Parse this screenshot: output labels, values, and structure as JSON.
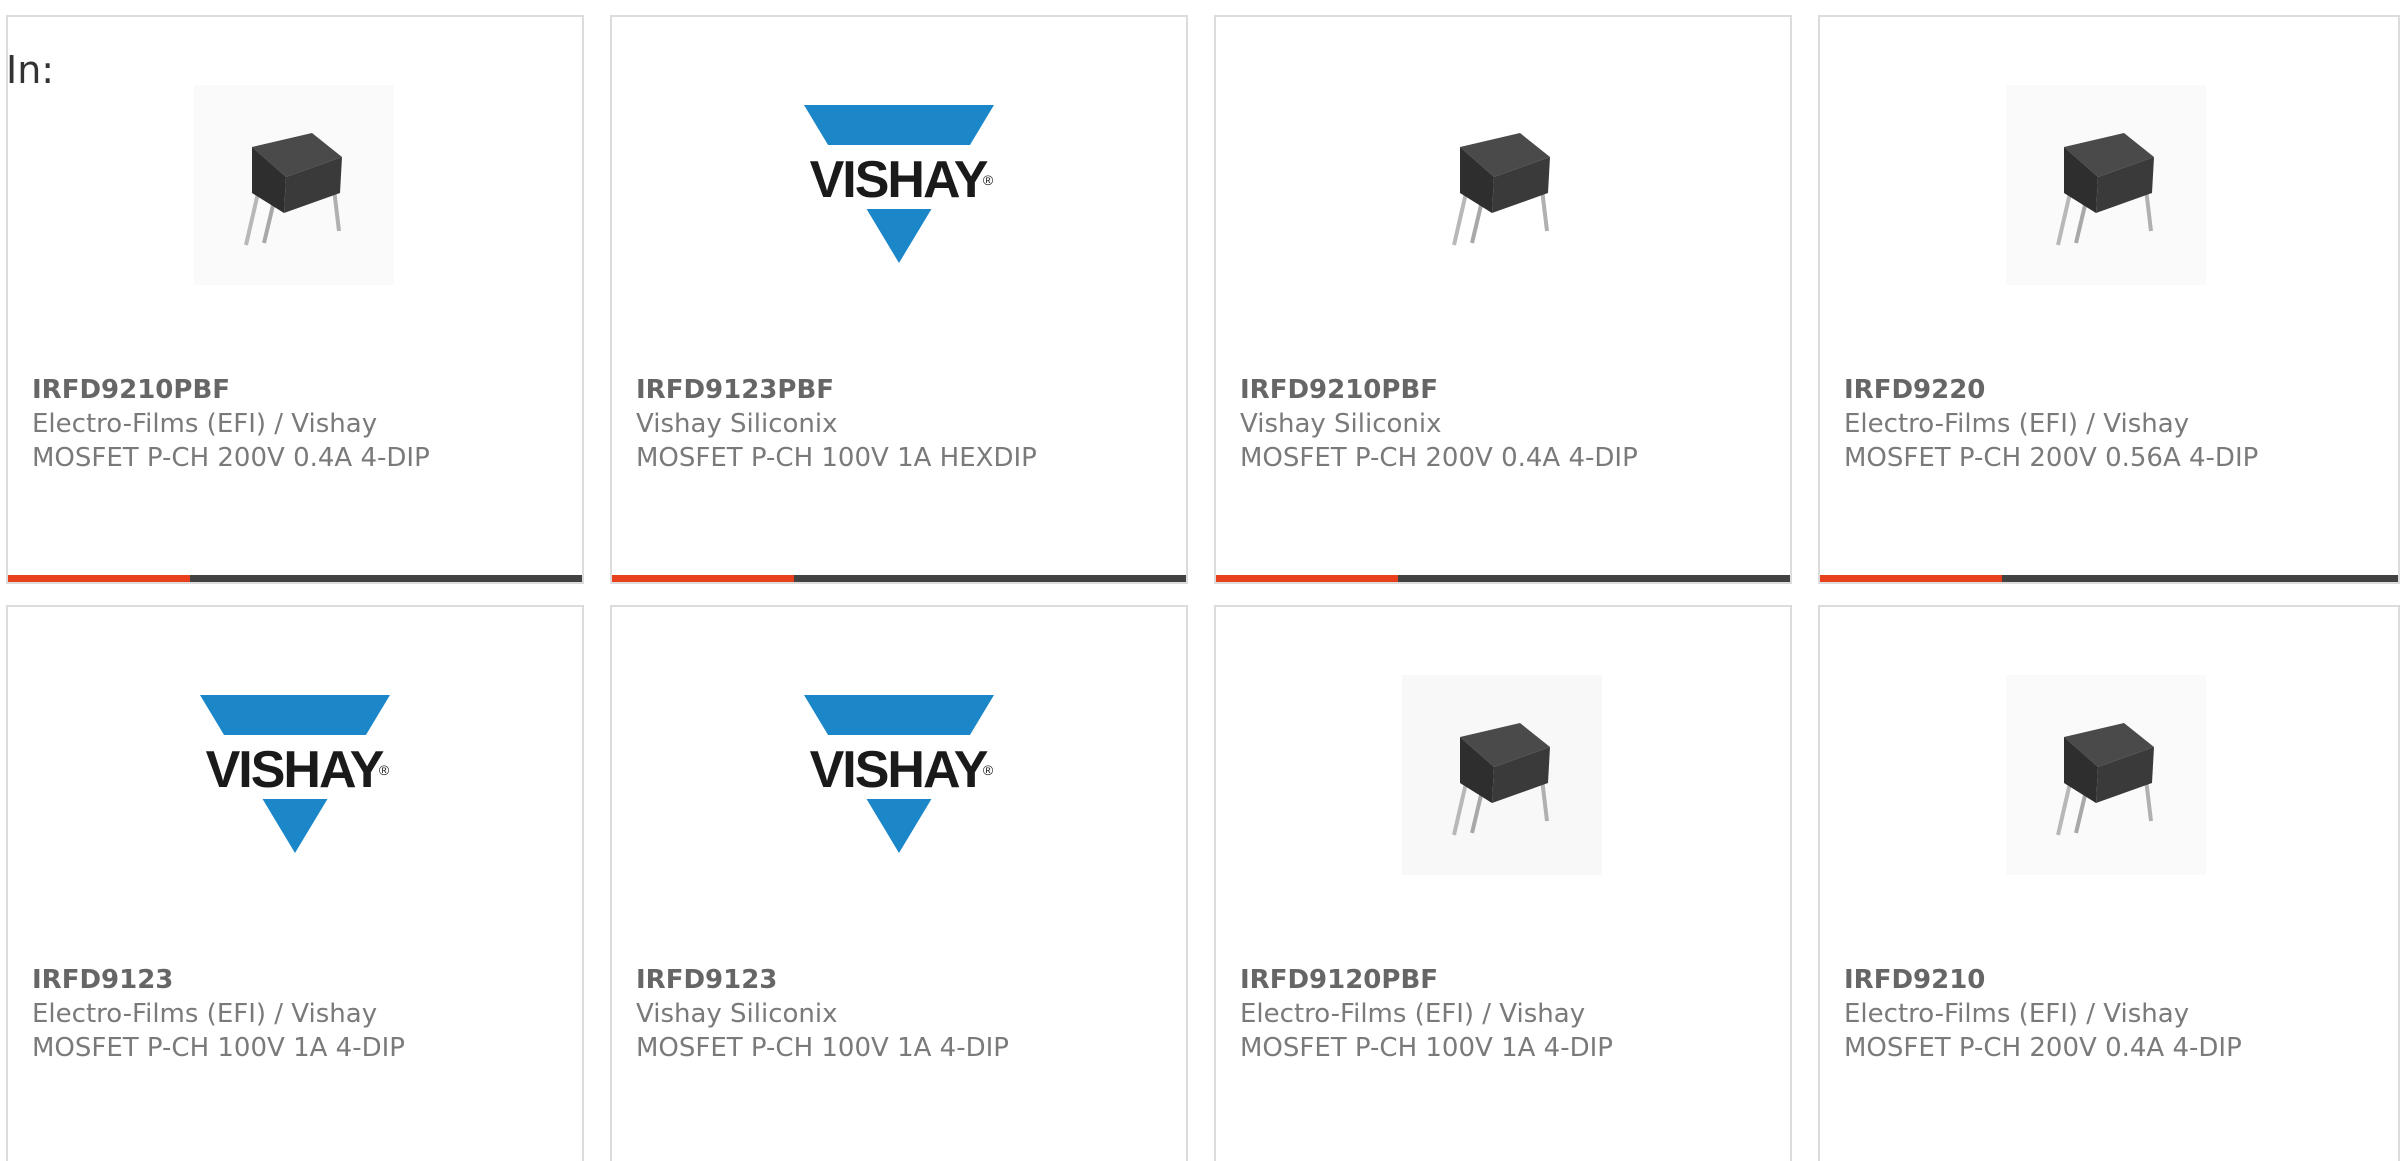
{
  "page": {
    "label": "In:"
  },
  "colors": {
    "accent": "#e8401c",
    "bar": "#424242",
    "vishay_blue": "#1b87c9",
    "border": "#dcdcdc",
    "text": "#7a7a7a"
  },
  "products": [
    {
      "part_number": "IRFD9210PBF",
      "manufacturer": "Electro-Films (EFI) / Vishay",
      "description": "MOSFET P-CH 200V 0.4A 4-DIP",
      "image": "chip-photo"
    },
    {
      "part_number": "IRFD9123PBF",
      "manufacturer": "Vishay Siliconix",
      "description": "MOSFET P-CH 100V 1A HEXDIP",
      "image": "vishay-logo"
    },
    {
      "part_number": "IRFD9210PBF",
      "manufacturer": "Vishay Siliconix",
      "description": "MOSFET P-CH 200V 0.4A 4-DIP",
      "image": "chip-photo"
    },
    {
      "part_number": "IRFD9220",
      "manufacturer": "Electro-Films (EFI) / Vishay",
      "description": "MOSFET P-CH 200V 0.56A 4-DIP",
      "image": "chip-photo"
    },
    {
      "part_number": "IRFD9123",
      "manufacturer": "Electro-Films (EFI) / Vishay",
      "description": "MOSFET P-CH 100V 1A 4-DIP",
      "image": "vishay-logo"
    },
    {
      "part_number": "IRFD9123",
      "manufacturer": "Vishay Siliconix",
      "description": "MOSFET P-CH 100V 1A 4-DIP",
      "image": "vishay-logo"
    },
    {
      "part_number": "IRFD9120PBF",
      "manufacturer": "Electro-Films (EFI) / Vishay",
      "description": "MOSFET P-CH 100V 1A 4-DIP",
      "image": "chip-photo"
    },
    {
      "part_number": "IRFD9210",
      "manufacturer": "Electro-Films (EFI) / Vishay",
      "description": "MOSFET P-CH 200V 0.4A 4-DIP",
      "image": "chip-photo"
    }
  ],
  "logo": {
    "text": "VISHAY",
    "mark": "®"
  }
}
